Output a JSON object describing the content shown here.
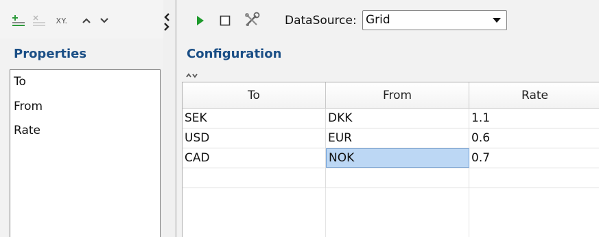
{
  "left_toolbar": {
    "icons": [
      "add-property-icon",
      "remove-property-icon",
      "xy-icon",
      "move-up-icon",
      "move-down-icon"
    ],
    "xy_label": "XY."
  },
  "properties": {
    "title": "Properties",
    "items": [
      "To",
      "From",
      "Rate"
    ]
  },
  "splitter": {
    "icons": [
      "collapse-left-icon",
      "expand-right-icon"
    ]
  },
  "right_toolbar": {
    "icons": [
      "run-icon",
      "stop-icon",
      "tools-icon"
    ],
    "datasource_label": "DataSource:",
    "datasource_value": "Grid"
  },
  "configuration": {
    "title": "Configuration",
    "columns": [
      "To",
      "From",
      "Rate"
    ],
    "rows": [
      [
        "SEK",
        "DKK",
        "1.1"
      ],
      [
        "USD",
        "EUR",
        "0.6"
      ],
      [
        "CAD",
        "NOK",
        "0.7"
      ],
      [
        "",
        "",
        ""
      ]
    ],
    "selected_cell": {
      "row": 2,
      "column": 1
    }
  },
  "colors": {
    "heading": "#1b4f86",
    "run_icon": "#1e9a2c",
    "selection": "#bcd7f4",
    "add_icon": "#2f9b3d"
  }
}
